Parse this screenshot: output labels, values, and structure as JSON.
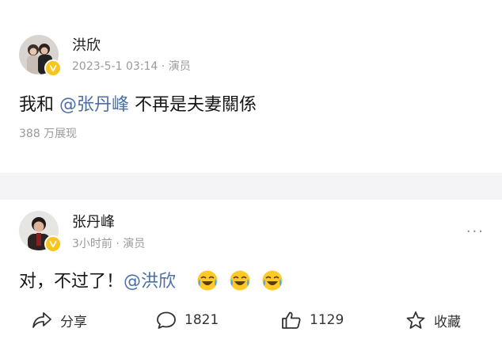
{
  "post1": {
    "author": "洪欣",
    "meta": "2023-5-1 03:14 · 演员",
    "content_before": "我和 ",
    "mention": "@张丹峰",
    "content_after": " 不再是夫妻關係",
    "views": "388 万展现"
  },
  "post2": {
    "author": "张丹峰",
    "meta": "3小时前 · 演员",
    "content_text": "对，不过了！",
    "mention": "@洪欣",
    "more": "···",
    "emoji_count": 3
  },
  "actions": {
    "share_label": "分享",
    "comment_count": "1821",
    "like_count": "1129",
    "favorite_label": "收藏"
  },
  "colors": {
    "mention": "#4a6fa8",
    "meta": "#9a9a9a",
    "badge": "#f7c51c",
    "separator": "#f4f4f6"
  },
  "icons": {
    "verified": "verified-v-icon",
    "share": "share-arrow-icon",
    "comment": "comment-bubble-icon",
    "like": "thumbs-up-icon",
    "favorite": "star-icon",
    "emoji": "laughing-crying-emoji-icon"
  }
}
